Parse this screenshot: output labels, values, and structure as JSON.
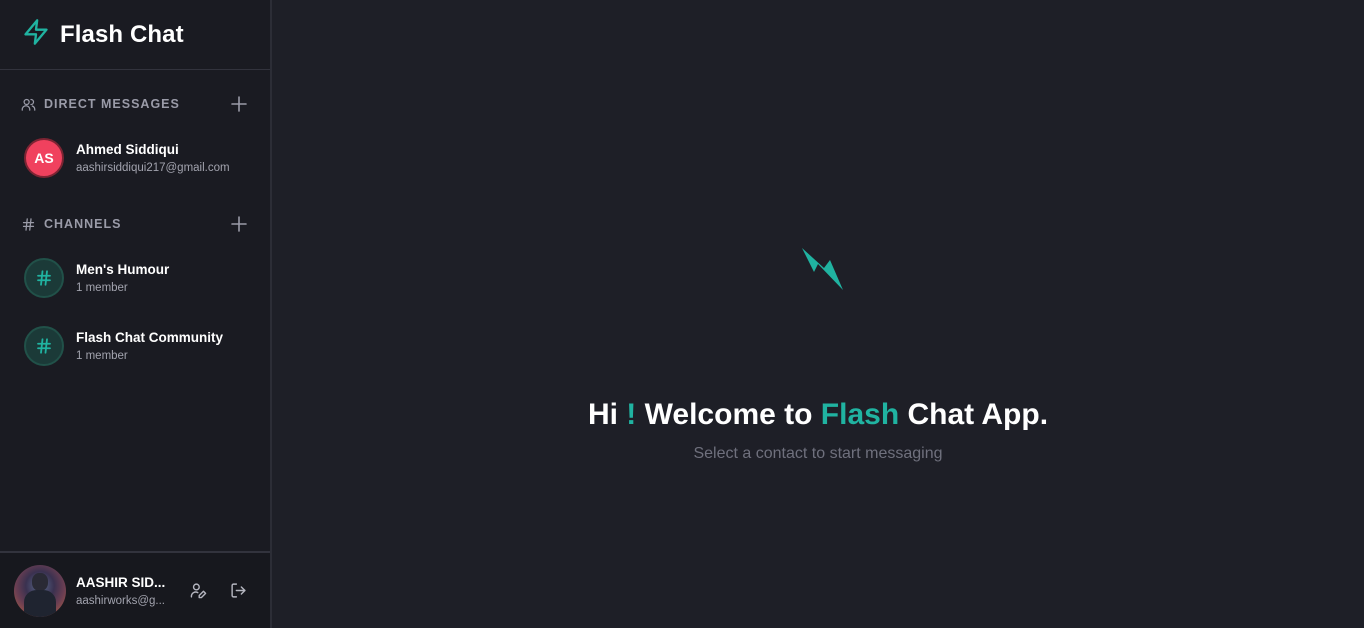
{
  "brand": {
    "title": "Flash Chat",
    "icon": "lightning-bolt-icon",
    "accent_color": "#20b3a1"
  },
  "direct_messages": {
    "label": "DIRECT MESSAGES",
    "items": [
      {
        "initials": "AS",
        "name": "Ahmed Siddiqui",
        "email": "aashirsiddiqui217@gmail.com",
        "avatar_color": "#f0415e"
      }
    ]
  },
  "channels": {
    "label": "CHANNELS",
    "items": [
      {
        "name": "Men's Humour",
        "members": "1 member"
      },
      {
        "name": "Flash Chat Community",
        "members": "1 member"
      }
    ]
  },
  "current_user": {
    "name": "AASHIR SID...",
    "email": "aashirworks@g..."
  },
  "welcome": {
    "hi": "Hi",
    "exclaim": "!",
    "welcome_to": "Welcome to",
    "flash": "Flash",
    "rest": "Chat App.",
    "subtitle": "Select a contact to start messaging"
  }
}
